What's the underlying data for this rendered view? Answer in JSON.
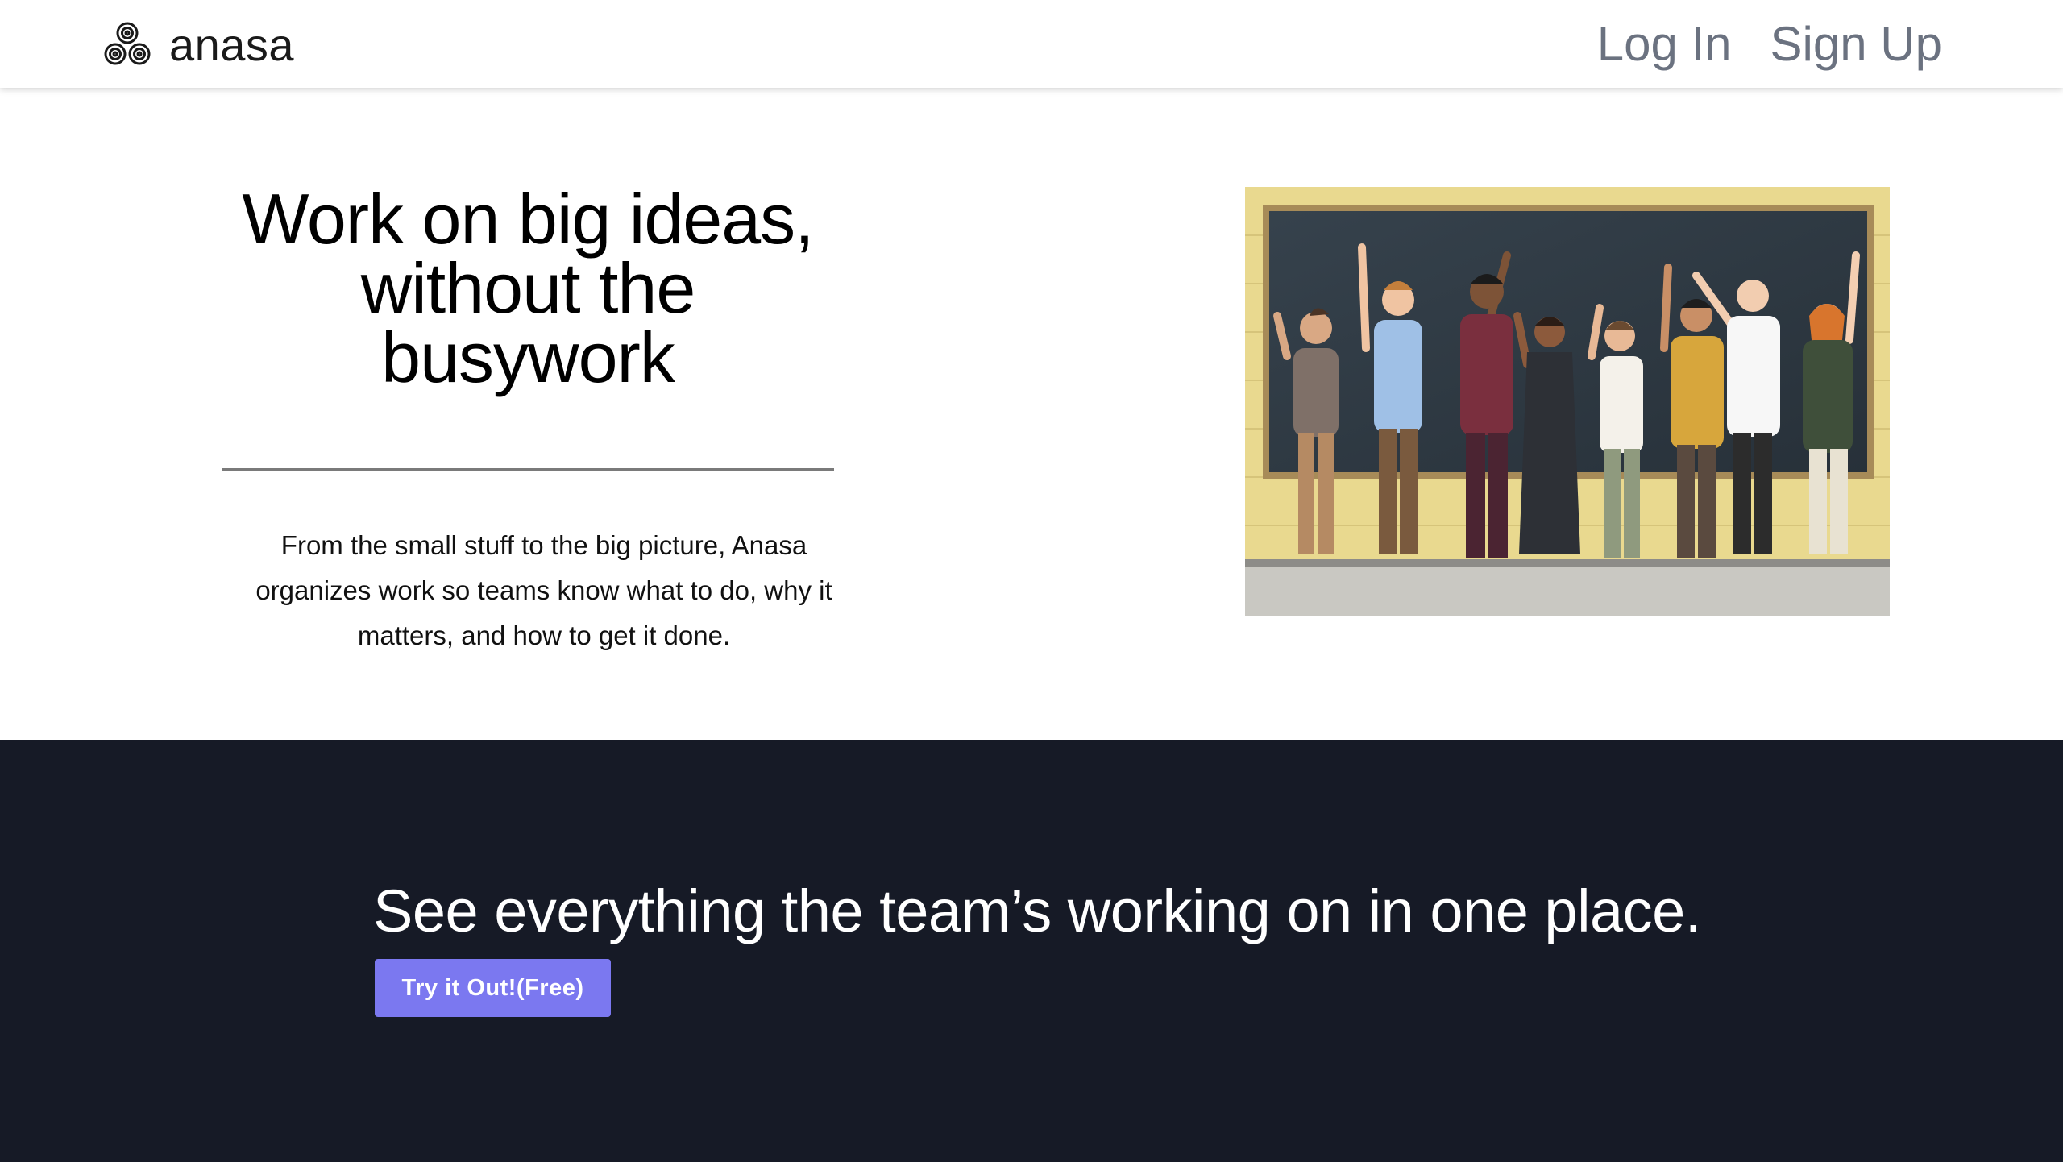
{
  "header": {
    "brand_name": "anasa",
    "logo_icon": "triple-spiral-logo-icon",
    "nav": {
      "login_label": "Log In",
      "signup_label": "Sign Up"
    }
  },
  "hero": {
    "title": "Work on big ideas, without the busywork",
    "description": "From the small stuff to the big picture, Anasa organizes work so teams know what to do, why it matters, and how to get it done.",
    "image_subject": "group of cheering people in front of a chalkboard"
  },
  "cta": {
    "heading": "See everything the team’s working on in one place.",
    "button_label": "Try it Out!(Free)"
  },
  "colors": {
    "header_background": "#ffffff",
    "nav_link": "#6b7280",
    "dark_section_background": "#161a26",
    "cta_button": "#7b78f0",
    "divider": "#7a7a7a"
  }
}
